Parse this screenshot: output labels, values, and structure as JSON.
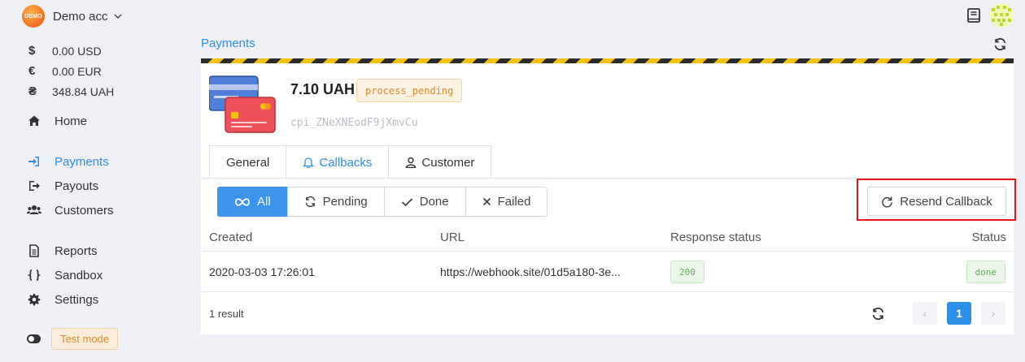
{
  "account": {
    "logo_text": "DEMO",
    "name": "Demo acc"
  },
  "balances": [
    {
      "symbol": "$",
      "amount": "0.00 USD"
    },
    {
      "symbol": "€",
      "amount": "0.00 EUR"
    },
    {
      "symbol": "₴",
      "amount": "348.84 UAH"
    }
  ],
  "nav": {
    "home": "Home",
    "payments": "Payments",
    "payouts": "Payouts",
    "customers": "Customers",
    "reports": "Reports",
    "sandbox": "Sandbox",
    "settings": "Settings"
  },
  "test_mode_label": "Test mode",
  "page_title": "Payments",
  "payment": {
    "amount": "7.10 UAH",
    "status": "process_pending",
    "id": "cpi_ZNeXNEodF9jXmvCu"
  },
  "tabs": {
    "general": "General",
    "callbacks": "Callbacks",
    "customer": "Customer"
  },
  "filters": {
    "all": "All",
    "pending": "Pending",
    "done": "Done",
    "failed": "Failed"
  },
  "resend_label": "Resend Callback",
  "table": {
    "headers": {
      "created": "Created",
      "url": "URL",
      "response_status": "Response status",
      "status": "Status"
    },
    "rows": [
      {
        "created": "2020-03-03 17:26:01",
        "url": "https://webhook.site/01d5a180-3e...",
        "response_status": "200",
        "status": "done"
      }
    ]
  },
  "result_count": "1 result",
  "pagination": {
    "prev": "‹",
    "current": "1",
    "next": "›"
  },
  "colors": {
    "accent": "#2d8fe8",
    "highlight": "#e8141c",
    "warning": "#e08a2a",
    "success": "#5fae57"
  }
}
